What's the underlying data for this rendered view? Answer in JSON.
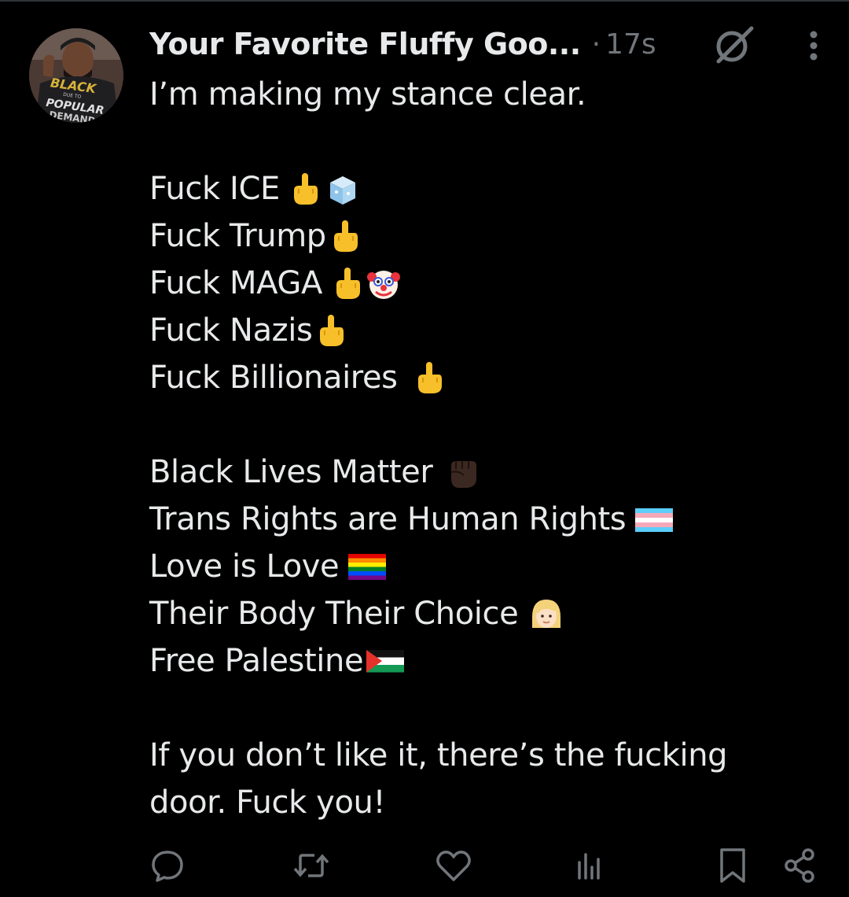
{
  "post": {
    "author_name": "Your Favorite Fluffy Goo...",
    "separator": "·",
    "timestamp": "17s",
    "avatar_shirt_text": "BLACK OUT TO POPULAR DEMAND",
    "lines": [
      {
        "text": "I’m making my stance clear.",
        "emoji": []
      },
      {
        "text": "",
        "emoji": []
      },
      {
        "text": "Fuck ICE",
        "emoji": [
          "middle-finger-emoji",
          "ice-cube-emoji"
        ]
      },
      {
        "text": "Fuck Trump",
        "emoji": [
          "middle-finger-emoji"
        ]
      },
      {
        "text": "Fuck MAGA",
        "emoji": [
          "middle-finger-emoji",
          "clown-face-emoji"
        ]
      },
      {
        "text": "Fuck Nazis",
        "emoji": [
          "middle-finger-emoji"
        ]
      },
      {
        "text": "Fuck Billionaires",
        "emoji": [
          "middle-finger-emoji"
        ]
      },
      {
        "text": "",
        "emoji": []
      },
      {
        "text": "Black Lives Matter",
        "emoji": [
          "raised-fist-emoji"
        ]
      },
      {
        "text": "Trans Rights are Human Rights",
        "emoji": [
          "transgender-flag-emoji"
        ]
      },
      {
        "text": "Love is Love",
        "emoji": [
          "rainbow-flag-emoji"
        ]
      },
      {
        "text": "Their Body Their Choice",
        "emoji": [
          "woman-face-emoji"
        ]
      },
      {
        "text": "Free Palestine",
        "emoji": [
          "palestine-flag-emoji"
        ]
      },
      {
        "text": "",
        "emoji": []
      },
      {
        "text": "If you don’t like it, there’s the fucking",
        "emoji": []
      },
      {
        "text": "door. Fuck you!",
        "emoji": []
      }
    ]
  },
  "header_icons": [
    "grok-icon",
    "more-options-icon"
  ],
  "actions": [
    {
      "name": "reply-icon"
    },
    {
      "name": "repost-icon"
    },
    {
      "name": "like-icon"
    },
    {
      "name": "views-icon"
    },
    {
      "name": "bookmark-icon"
    },
    {
      "name": "share-icon"
    }
  ],
  "colors": {
    "background": "#000000",
    "text_primary": "#e7e9ea",
    "text_secondary": "#71767b",
    "divider": "#2f3336"
  }
}
